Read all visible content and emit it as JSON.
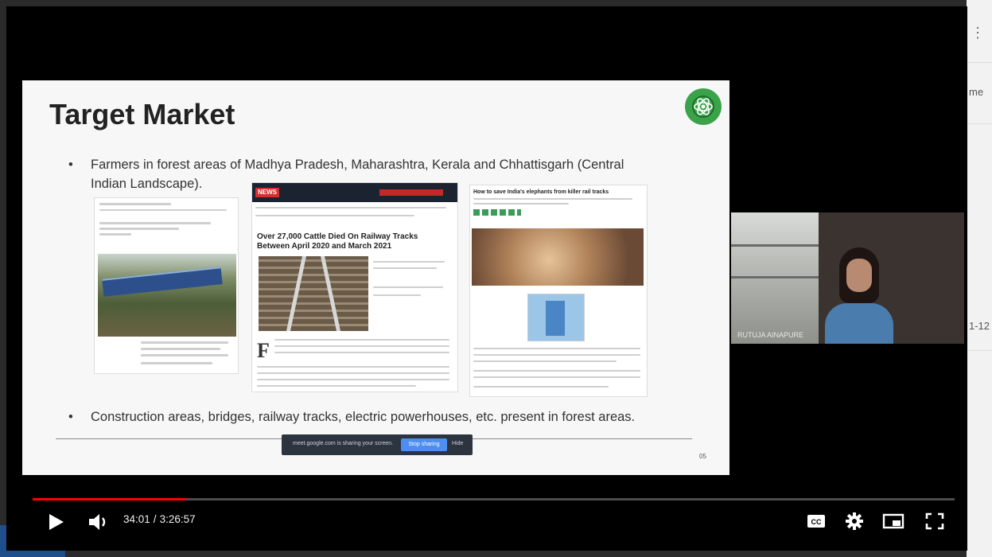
{
  "slide": {
    "title": "Target Market",
    "bullet1": "Farmers in forest areas of Madhya Pradesh, Maharashtra, Kerala  and Chhattisgarh (Central Indian Landscape).",
    "bullet2": "Construction areas, bridges, railway tracks, electric powerhouses, etc. present in forest areas.",
    "page_number": "05",
    "article2_headline": "Over 27,000 Cattle Died On Railway Tracks Between April 2020 and March 2021",
    "article3_headline": "How to save India's elephants from killer rail tracks",
    "share_bar_text": "meet.google.com is sharing your screen.",
    "share_stop_label": "Stop sharing",
    "share_hide_label": "Hide"
  },
  "webcam": {
    "name": "RUTUJA AINAPURE"
  },
  "player": {
    "current_time": "34:01",
    "duration": "3:26:57",
    "progress_fraction": 0.166,
    "accent_color": "#ff0000",
    "icons": [
      "play-icon",
      "volume-icon",
      "captions-icon",
      "settings-icon",
      "miniplayer-icon",
      "fullscreen-icon"
    ]
  },
  "background": {
    "side_text_1": "me",
    "side_text_2": "1-12"
  }
}
